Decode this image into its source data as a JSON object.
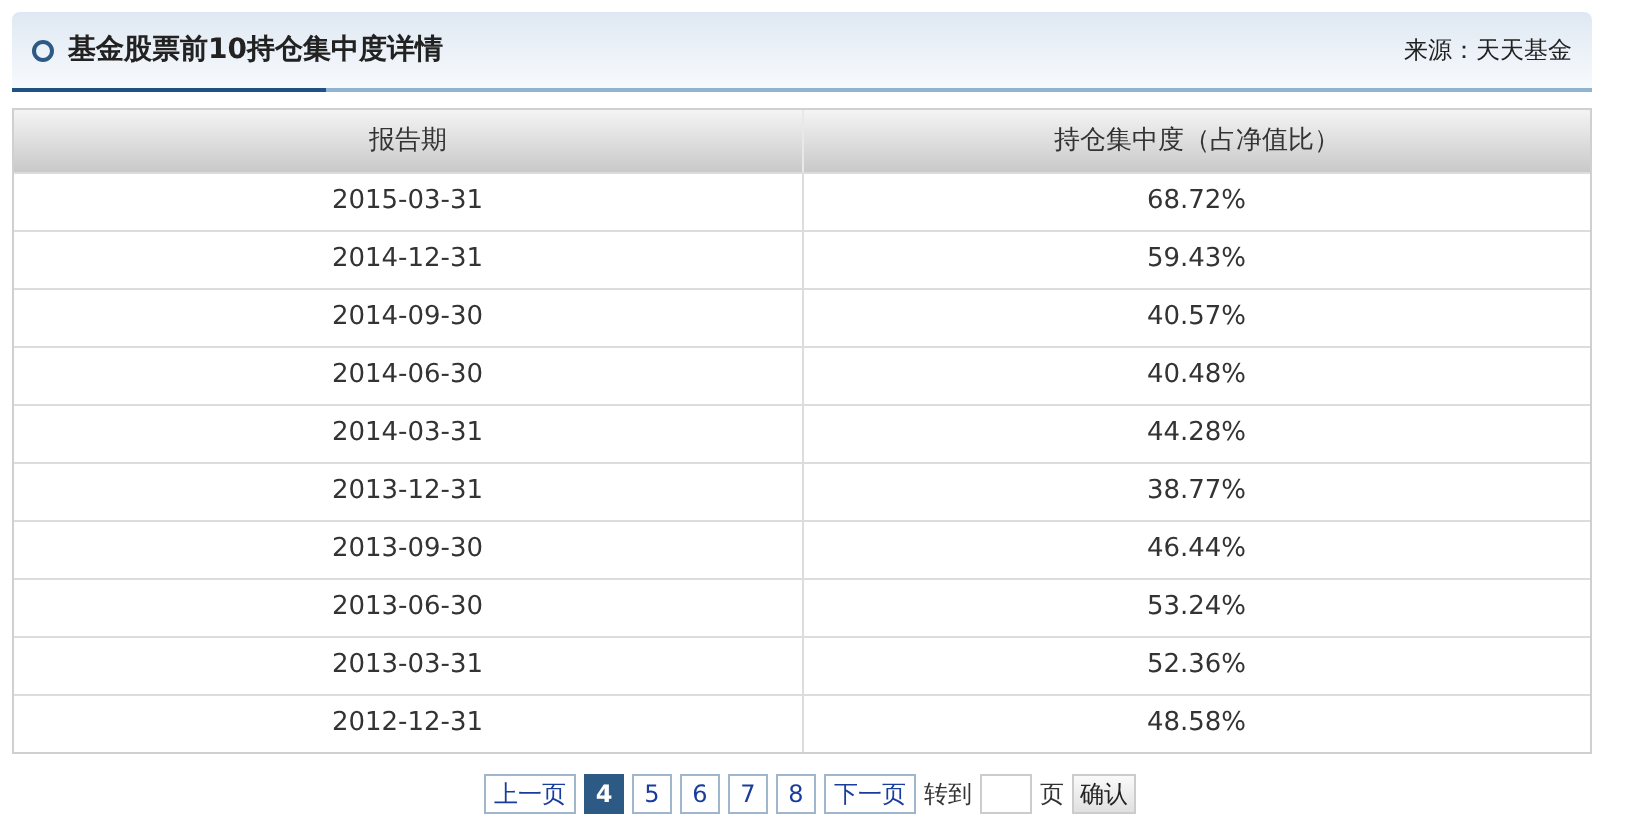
{
  "panel": {
    "title": "基金股票前10持仓集中度详情",
    "source": "来源：天天基金"
  },
  "table": {
    "columns": [
      "报告期",
      "持仓集中度（占净值比）"
    ],
    "rows": [
      [
        "2015-03-31",
        "68.72%"
      ],
      [
        "2014-12-31",
        "59.43%"
      ],
      [
        "2014-09-30",
        "40.57%"
      ],
      [
        "2014-06-30",
        "40.48%"
      ],
      [
        "2014-03-31",
        "44.28%"
      ],
      [
        "2013-12-31",
        "38.77%"
      ],
      [
        "2013-09-30",
        "46.44%"
      ],
      [
        "2013-06-30",
        "53.24%"
      ],
      [
        "2013-03-31",
        "52.36%"
      ],
      [
        "2012-12-31",
        "48.58%"
      ]
    ]
  },
  "pagination": {
    "prev": "上一页",
    "pages": [
      {
        "label": "4",
        "selected": true
      },
      {
        "label": "5",
        "selected": false
      },
      {
        "label": "6",
        "selected": false
      },
      {
        "label": "7",
        "selected": false
      },
      {
        "label": "8",
        "selected": false
      }
    ],
    "next": "下一页",
    "goto_label": "转到",
    "page_unit": "页",
    "confirm": "确认"
  }
}
